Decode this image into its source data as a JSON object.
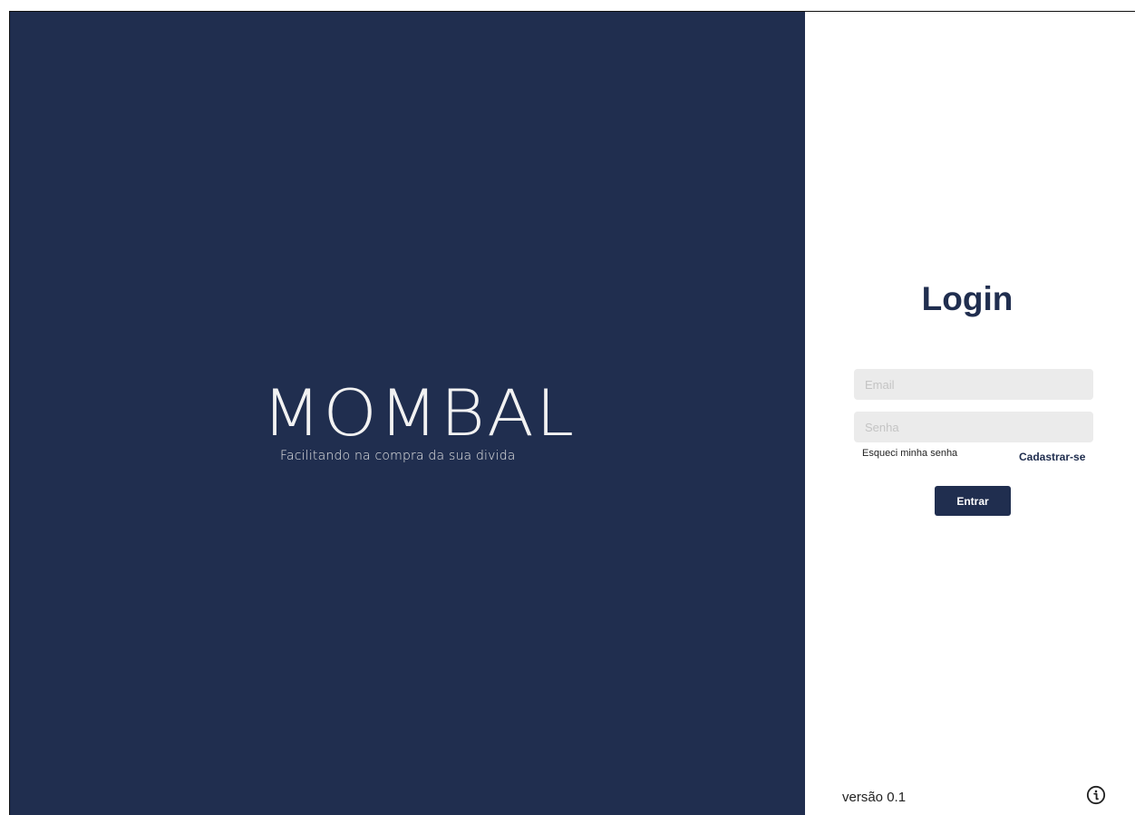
{
  "brand": {
    "name": "MOMBAL",
    "tagline": "Facilitando na compra da sua divida"
  },
  "login": {
    "title": "Login",
    "email_placeholder": "Email",
    "password_placeholder": "Senha",
    "forgot_password": "Esqueci minha senha",
    "signup": "Cadastrar-se",
    "submit": "Entrar"
  },
  "footer": {
    "version": "versão 0.1",
    "info_icon": "info-icon"
  },
  "colors": {
    "brand_navy": "#202e4f",
    "field_background": "#ebebeb",
    "page_background": "#ffffff"
  }
}
